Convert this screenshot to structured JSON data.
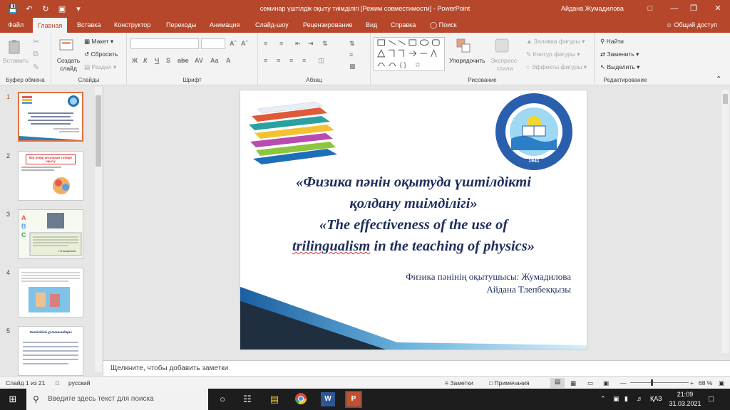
{
  "window": {
    "title": "семинар үштілдік оқыту тиімділігі [Режим совместимости]  -  PowerPoint",
    "user": "Айдана Жумадилова"
  },
  "tabs": [
    "Файл",
    "Главная",
    "Вставка",
    "Конструктор",
    "Переходы",
    "Анимация",
    "Слайд-шоу",
    "Рецензирование",
    "Вид",
    "Справка",
    "Поиск"
  ],
  "share_label": "Общий доступ",
  "ribbon": {
    "clipboard": {
      "label": "Буфер обмена",
      "paste": "Вставить"
    },
    "slides": {
      "label": "Слайды",
      "new_slide": "Создать слайд",
      "layout": "Макет",
      "reset": "Сбросить",
      "section": "Раздел"
    },
    "font": {
      "label": "Шрифт"
    },
    "paragraph": {
      "label": "Абзац"
    },
    "drawing": {
      "label": "Рисование",
      "arrange": "Упорядочить",
      "quick_styles": "Экспресс-стили",
      "fill": "Заливка фигуры",
      "outline": "Контур фигуры",
      "effects": "Эффекты фигуры"
    },
    "editing": {
      "label": "Редактирование",
      "find": "Найти",
      "replace": "Заменить",
      "select": "Выделить"
    }
  },
  "slides_panel": {
    "numbers": [
      "1",
      "2",
      "3",
      "4",
      "5"
    ],
    "thumb2_text": "Бір пәнді ағылшын тілінде оқыту",
    "thumb3_caption": "Н.Назарбаев",
    "thumb5_title": "Үштілділік ұстанымдары"
  },
  "slide": {
    "title_kz_line1": "«Физика пәнін оқытуда үштілдікті",
    "title_kz_line2": "қолдану тиімділігі»",
    "title_en_line1": "«The effectiveness of the use of",
    "title_en_line2_a": "trilingualism",
    "title_en_line2_b": " in the teaching of physics»",
    "author_line1": "Физика пәнінің оқытушысы: Жумадилова",
    "author_line2": "Айдана Тлепбекқызы",
    "logo_year": "1941"
  },
  "notes_placeholder": "Щелкните, чтобы добавить заметки",
  "status": {
    "slide_counter": "Слайд 1 из 21",
    "language": "русский",
    "notes": "Заметки",
    "comments": "Примечания",
    "zoom": "68 %"
  },
  "taskbar": {
    "search_placeholder": "Введите здесь текст для поиска",
    "lang": "ҚАЗ",
    "time": "21:09",
    "date": "31.03.2021"
  },
  "colors": {
    "accent": "#b7472a",
    "title_text": "#1f2f5c"
  }
}
